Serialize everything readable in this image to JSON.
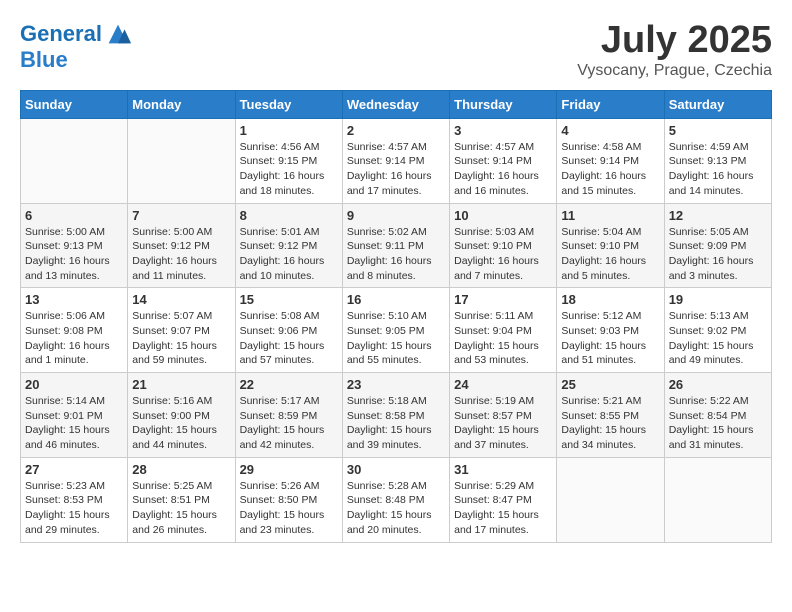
{
  "logo": {
    "line1": "General",
    "line2": "Blue"
  },
  "title": "July 2025",
  "subtitle": "Vysocany, Prague, Czechia",
  "weekdays": [
    "Sunday",
    "Monday",
    "Tuesday",
    "Wednesday",
    "Thursday",
    "Friday",
    "Saturday"
  ],
  "weeks": [
    [
      {
        "day": "",
        "info": ""
      },
      {
        "day": "",
        "info": ""
      },
      {
        "day": "1",
        "info": "Sunrise: 4:56 AM\nSunset: 9:15 PM\nDaylight: 16 hours and 18 minutes."
      },
      {
        "day": "2",
        "info": "Sunrise: 4:57 AM\nSunset: 9:14 PM\nDaylight: 16 hours and 17 minutes."
      },
      {
        "day": "3",
        "info": "Sunrise: 4:57 AM\nSunset: 9:14 PM\nDaylight: 16 hours and 16 minutes."
      },
      {
        "day": "4",
        "info": "Sunrise: 4:58 AM\nSunset: 9:14 PM\nDaylight: 16 hours and 15 minutes."
      },
      {
        "day": "5",
        "info": "Sunrise: 4:59 AM\nSunset: 9:13 PM\nDaylight: 16 hours and 14 minutes."
      }
    ],
    [
      {
        "day": "6",
        "info": "Sunrise: 5:00 AM\nSunset: 9:13 PM\nDaylight: 16 hours and 13 minutes."
      },
      {
        "day": "7",
        "info": "Sunrise: 5:00 AM\nSunset: 9:12 PM\nDaylight: 16 hours and 11 minutes."
      },
      {
        "day": "8",
        "info": "Sunrise: 5:01 AM\nSunset: 9:12 PM\nDaylight: 16 hours and 10 minutes."
      },
      {
        "day": "9",
        "info": "Sunrise: 5:02 AM\nSunset: 9:11 PM\nDaylight: 16 hours and 8 minutes."
      },
      {
        "day": "10",
        "info": "Sunrise: 5:03 AM\nSunset: 9:10 PM\nDaylight: 16 hours and 7 minutes."
      },
      {
        "day": "11",
        "info": "Sunrise: 5:04 AM\nSunset: 9:10 PM\nDaylight: 16 hours and 5 minutes."
      },
      {
        "day": "12",
        "info": "Sunrise: 5:05 AM\nSunset: 9:09 PM\nDaylight: 16 hours and 3 minutes."
      }
    ],
    [
      {
        "day": "13",
        "info": "Sunrise: 5:06 AM\nSunset: 9:08 PM\nDaylight: 16 hours and 1 minute."
      },
      {
        "day": "14",
        "info": "Sunrise: 5:07 AM\nSunset: 9:07 PM\nDaylight: 15 hours and 59 minutes."
      },
      {
        "day": "15",
        "info": "Sunrise: 5:08 AM\nSunset: 9:06 PM\nDaylight: 15 hours and 57 minutes."
      },
      {
        "day": "16",
        "info": "Sunrise: 5:10 AM\nSunset: 9:05 PM\nDaylight: 15 hours and 55 minutes."
      },
      {
        "day": "17",
        "info": "Sunrise: 5:11 AM\nSunset: 9:04 PM\nDaylight: 15 hours and 53 minutes."
      },
      {
        "day": "18",
        "info": "Sunrise: 5:12 AM\nSunset: 9:03 PM\nDaylight: 15 hours and 51 minutes."
      },
      {
        "day": "19",
        "info": "Sunrise: 5:13 AM\nSunset: 9:02 PM\nDaylight: 15 hours and 49 minutes."
      }
    ],
    [
      {
        "day": "20",
        "info": "Sunrise: 5:14 AM\nSunset: 9:01 PM\nDaylight: 15 hours and 46 minutes."
      },
      {
        "day": "21",
        "info": "Sunrise: 5:16 AM\nSunset: 9:00 PM\nDaylight: 15 hours and 44 minutes."
      },
      {
        "day": "22",
        "info": "Sunrise: 5:17 AM\nSunset: 8:59 PM\nDaylight: 15 hours and 42 minutes."
      },
      {
        "day": "23",
        "info": "Sunrise: 5:18 AM\nSunset: 8:58 PM\nDaylight: 15 hours and 39 minutes."
      },
      {
        "day": "24",
        "info": "Sunrise: 5:19 AM\nSunset: 8:57 PM\nDaylight: 15 hours and 37 minutes."
      },
      {
        "day": "25",
        "info": "Sunrise: 5:21 AM\nSunset: 8:55 PM\nDaylight: 15 hours and 34 minutes."
      },
      {
        "day": "26",
        "info": "Sunrise: 5:22 AM\nSunset: 8:54 PM\nDaylight: 15 hours and 31 minutes."
      }
    ],
    [
      {
        "day": "27",
        "info": "Sunrise: 5:23 AM\nSunset: 8:53 PM\nDaylight: 15 hours and 29 minutes."
      },
      {
        "day": "28",
        "info": "Sunrise: 5:25 AM\nSunset: 8:51 PM\nDaylight: 15 hours and 26 minutes."
      },
      {
        "day": "29",
        "info": "Sunrise: 5:26 AM\nSunset: 8:50 PM\nDaylight: 15 hours and 23 minutes."
      },
      {
        "day": "30",
        "info": "Sunrise: 5:28 AM\nSunset: 8:48 PM\nDaylight: 15 hours and 20 minutes."
      },
      {
        "day": "31",
        "info": "Sunrise: 5:29 AM\nSunset: 8:47 PM\nDaylight: 15 hours and 17 minutes."
      },
      {
        "day": "",
        "info": ""
      },
      {
        "day": "",
        "info": ""
      }
    ]
  ]
}
